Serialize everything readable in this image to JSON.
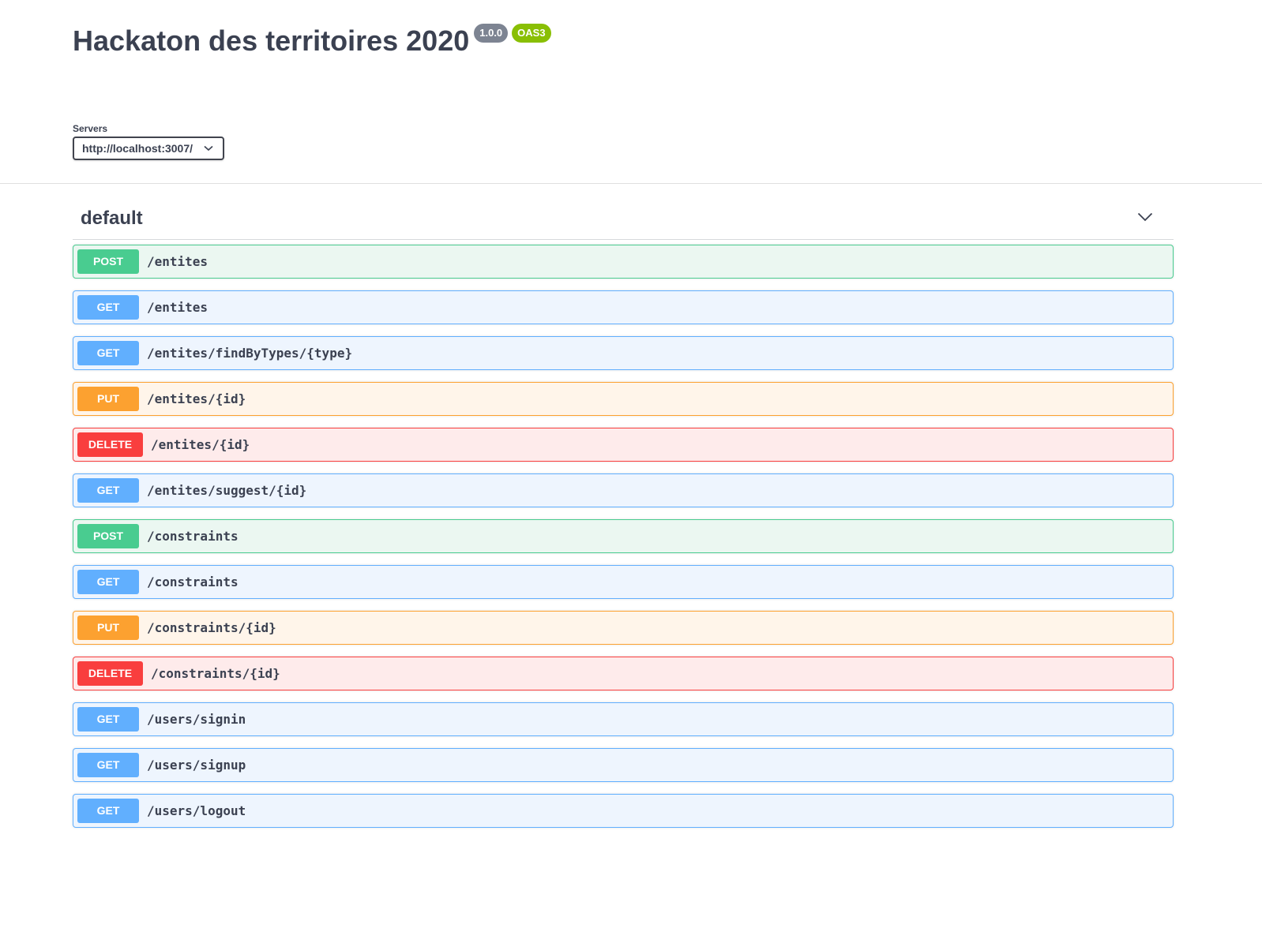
{
  "info": {
    "title": "Hackaton des territoires 2020",
    "version": "1.0.0",
    "oas": "OAS3"
  },
  "servers": {
    "label": "Servers",
    "selected": "http://localhost:3007/"
  },
  "section": {
    "title": "default"
  },
  "operations": [
    {
      "method": "POST",
      "path": "/entites"
    },
    {
      "method": "GET",
      "path": "/entites"
    },
    {
      "method": "GET",
      "path": "/entites/findByTypes/{type}"
    },
    {
      "method": "PUT",
      "path": "/entites/{id}"
    },
    {
      "method": "DELETE",
      "path": "/entites/{id}"
    },
    {
      "method": "GET",
      "path": "/entites/suggest/{id}"
    },
    {
      "method": "POST",
      "path": "/constraints"
    },
    {
      "method": "GET",
      "path": "/constraints"
    },
    {
      "method": "PUT",
      "path": "/constraints/{id}"
    },
    {
      "method": "DELETE",
      "path": "/constraints/{id}"
    },
    {
      "method": "GET",
      "path": "/users/signin"
    },
    {
      "method": "GET",
      "path": "/users/signup"
    },
    {
      "method": "GET",
      "path": "/users/logout"
    }
  ],
  "colors": {
    "post": "#49cc90",
    "get": "#61affe",
    "put": "#fca130",
    "delete": "#f93e3e",
    "version_badge": "#7d8492",
    "oas_badge": "#89bf04"
  }
}
